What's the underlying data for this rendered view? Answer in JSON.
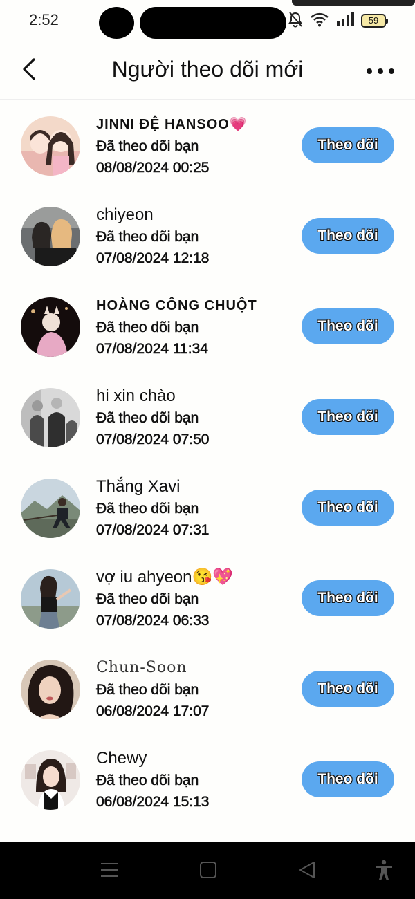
{
  "status_bar": {
    "time": "2:52",
    "battery": "59",
    "icons": [
      "silent-bell-icon",
      "wifi-icon",
      "signal-icon",
      "battery-icon"
    ]
  },
  "header": {
    "title": "Người theo dõi mới",
    "back_icon": "chevron-left-icon",
    "more_icon": "more-dots-icon"
  },
  "colors": {
    "follow_button": "#5ba8ef",
    "background": "#fefefc",
    "nav_bar": "#000000"
  },
  "followers": [
    {
      "name": "JINNI ĐỆ HANSOO💗",
      "status": "Đã theo dõi bạn",
      "date": "08/08/2024 00:25",
      "button": "Theo dõi"
    },
    {
      "name": "chiyeon",
      "status": "Đã theo dõi bạn",
      "date": "07/08/2024 12:18",
      "button": "Theo dõi"
    },
    {
      "name": "HOÀNG CÔNG CHUỘT",
      "status": "Đã theo dõi bạn",
      "date": "07/08/2024 11:34",
      "button": "Theo dõi"
    },
    {
      "name": "hi xin chào",
      "status": "Đã theo dõi bạn",
      "date": "07/08/2024 07:50",
      "button": "Theo dõi"
    },
    {
      "name": "Thắng Xavi",
      "status": "Đã theo dõi bạn",
      "date": "07/08/2024 07:31",
      "button": "Theo dõi"
    },
    {
      "name": "vợ iu ahyeon😘💖",
      "status": "Đã theo dõi bạn",
      "date": "07/08/2024 06:33",
      "button": "Theo dõi"
    },
    {
      "name": "Chun-Soon",
      "status": "Đã theo dõi bạn",
      "date": "06/08/2024 17:07",
      "button": "Theo dõi"
    },
    {
      "name": "Chewy",
      "status": "Đã theo dõi bạn",
      "date": "06/08/2024 15:13",
      "button": "Theo dõi"
    }
  ],
  "nav_bar": {
    "icons": [
      "menu-icon",
      "home-square-icon",
      "back-triangle-icon",
      "accessibility-icon"
    ]
  }
}
